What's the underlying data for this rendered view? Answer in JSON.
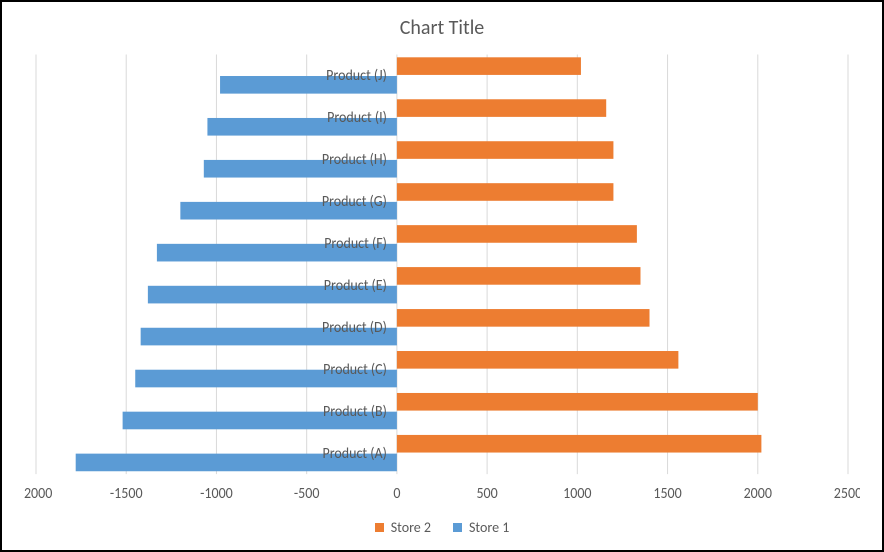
{
  "chart_data": {
    "type": "bar",
    "orientation": "horizontal",
    "title": "Chart Title",
    "xlabel": "",
    "ylabel": "",
    "xlim": [
      -2000,
      2500
    ],
    "xticks": [
      -2000,
      -1500,
      -1000,
      -500,
      0,
      500,
      1000,
      1500,
      2000,
      2500
    ],
    "categories": [
      "Product (A)",
      "Product (B)",
      "Product (C)",
      "Product (D)",
      "Product (E)",
      "Product (F)",
      "Product (G)",
      "Product (H)",
      "Product (I)",
      "Product (J)"
    ],
    "series": [
      {
        "name": "Store 2",
        "color": "#ed7d31",
        "values": [
          2020,
          2000,
          1560,
          1400,
          1350,
          1330,
          1200,
          1200,
          1160,
          1020
        ]
      },
      {
        "name": "Store 1",
        "color": "#5b9bd5",
        "values": [
          -1780,
          -1520,
          -1450,
          -1420,
          -1380,
          -1330,
          -1200,
          -1070,
          -1050,
          -980
        ]
      }
    ],
    "legend_order": [
      "Store 2",
      "Store 1"
    ],
    "grid": {
      "x": true,
      "y": false
    }
  }
}
